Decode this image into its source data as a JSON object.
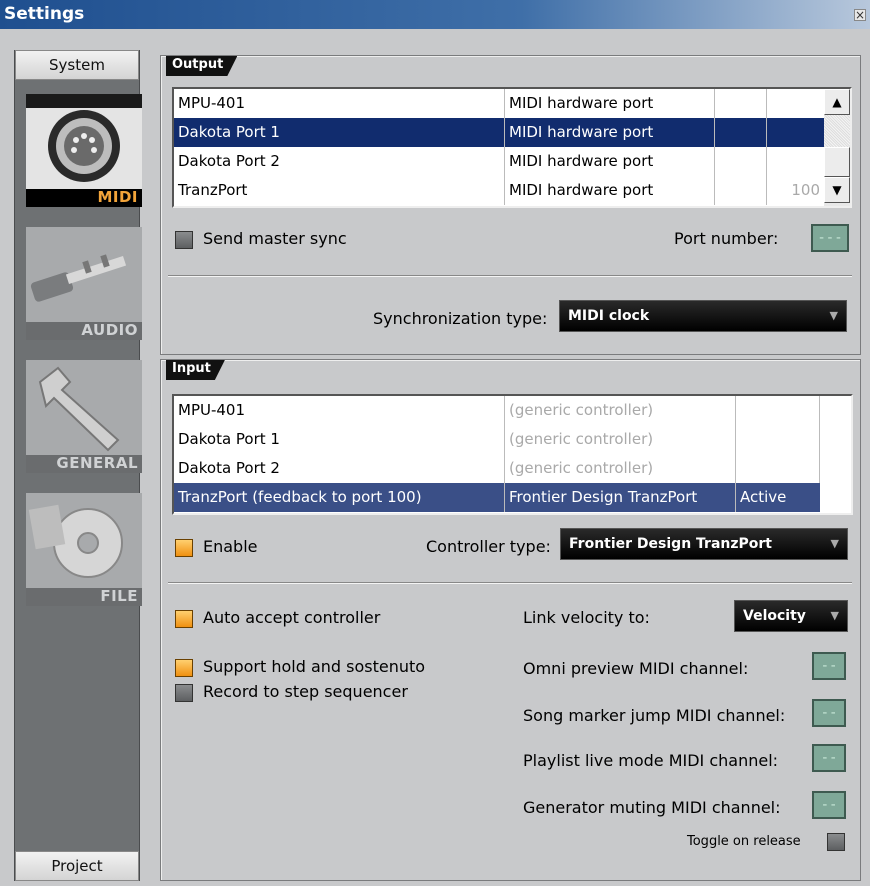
{
  "window": {
    "title": "Settings",
    "close_glyph": "×"
  },
  "sidebar": {
    "system_label": "System",
    "project_label": "Project",
    "categories": [
      {
        "label": "MIDI",
        "icon": "midi-connector-icon"
      },
      {
        "label": "AUDIO",
        "icon": "audio-jack-icon"
      },
      {
        "label": "GENERAL",
        "icon": "wrench-icon"
      },
      {
        "label": "FILE",
        "icon": "disc-icon"
      }
    ]
  },
  "output": {
    "tag": "Output",
    "rows": [
      {
        "name": "MPU-401",
        "type": "MIDI hardware port",
        "port": ""
      },
      {
        "name": "Dakota Port 1",
        "type": "MIDI hardware port",
        "port": ""
      },
      {
        "name": "Dakota Port 2",
        "type": "MIDI hardware port",
        "port": ""
      },
      {
        "name": "TranzPort",
        "type": "MIDI hardware port",
        "port": "100"
      }
    ],
    "send_master_sync": "Send master sync",
    "port_number_label": "Port number:",
    "port_number_value": "---",
    "sync_type_label": "Synchronization type:",
    "sync_type_value": "MIDI clock"
  },
  "input": {
    "tag": "Input",
    "rows": [
      {
        "name": "MPU-401",
        "controller": "(generic controller)",
        "status": ""
      },
      {
        "name": "Dakota Port 1",
        "controller": "(generic controller)",
        "status": ""
      },
      {
        "name": "Dakota Port 2",
        "controller": "(generic controller)",
        "status": ""
      },
      {
        "name": "TranzPort (feedback to port 100)",
        "controller": "Frontier Design TranzPort",
        "status": "Active"
      }
    ],
    "enable_label": "Enable",
    "controller_type_label": "Controller type:",
    "controller_type_value": "Frontier Design TranzPort",
    "auto_accept": "Auto accept controller",
    "support_hold": "Support hold and sostenuto",
    "record_step": "Record to step sequencer",
    "link_velocity_label": "Link velocity to:",
    "link_velocity_value": "Velocity",
    "omni_preview": "Omni preview MIDI channel:",
    "song_marker": "Song marker jump MIDI channel:",
    "playlist_live": "Playlist live mode MIDI channel:",
    "generator_muting": "Generator muting MIDI channel:",
    "channel_value": "--",
    "toggle_on_release": "Toggle on release"
  },
  "colors": {
    "selection": "#112c6e",
    "active_row": "#3a4f87",
    "check_on": "#f09010",
    "lcd": "#7fa898"
  }
}
